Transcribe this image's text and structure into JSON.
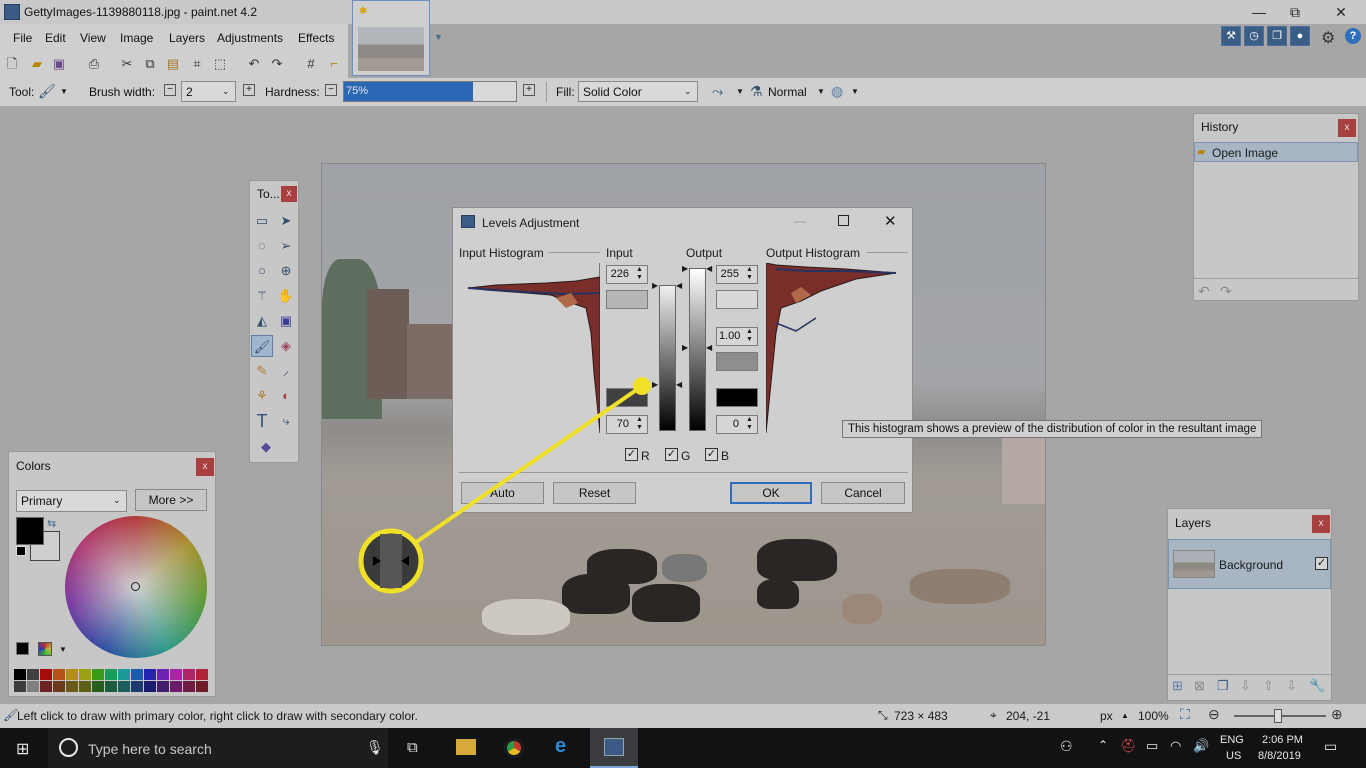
{
  "window": {
    "title": "GettyImages-1139880118.jpg - paint.net 4.2",
    "minimize": "—",
    "restore": "⧉",
    "close": "✕"
  },
  "menu": [
    "File",
    "Edit",
    "View",
    "Image",
    "Layers",
    "Adjustments",
    "Effects"
  ],
  "toolbar": {
    "tool_label": "Tool:",
    "brush_width_label": "Brush width:",
    "brush_width_value": "2",
    "hardness_label": "Hardness:",
    "hardness_value": "75%",
    "hardness_fraction": 0.75,
    "fill_label": "Fill:",
    "fill_value": "Solid Color",
    "blend_mode": "Normal"
  },
  "tools_panel": {
    "title": "To..."
  },
  "history": {
    "title": "History",
    "items": [
      "Open Image"
    ]
  },
  "colors": {
    "title": "Colors",
    "mode": "Primary",
    "more_button": "More >>",
    "primary_color": "#000000",
    "secondary_color": "#ffffff"
  },
  "layers": {
    "title": "Layers",
    "items": [
      {
        "name": "Background",
        "visible": true
      }
    ]
  },
  "levels": {
    "title": "Levels Adjustment",
    "input_histogram_label": "Input Histogram",
    "input_label": "Input",
    "output_label": "Output",
    "output_histogram_label": "Output Histogram",
    "input_high": "226",
    "input_low": "70",
    "output_high": "255",
    "gamma": "1.00",
    "output_low": "0",
    "channels": {
      "r": "R",
      "g": "G",
      "b": "B"
    },
    "auto_button": "Auto",
    "reset_button": "Reset",
    "ok_button": "OK",
    "cancel_button": "Cancel"
  },
  "tooltip": "This histogram shows a preview of the distribution of color in the resultant image",
  "status": {
    "hint": "Left click to draw with primary color, right click to draw with secondary color.",
    "image_size": "723 × 483",
    "cursor_pos": "204, -21",
    "unit": "px",
    "zoom": "100%"
  },
  "taskbar": {
    "search_placeholder": "Type here to search",
    "lang": "ENG",
    "region": "US",
    "time": "2:06 PM",
    "date": "8/8/2019"
  }
}
